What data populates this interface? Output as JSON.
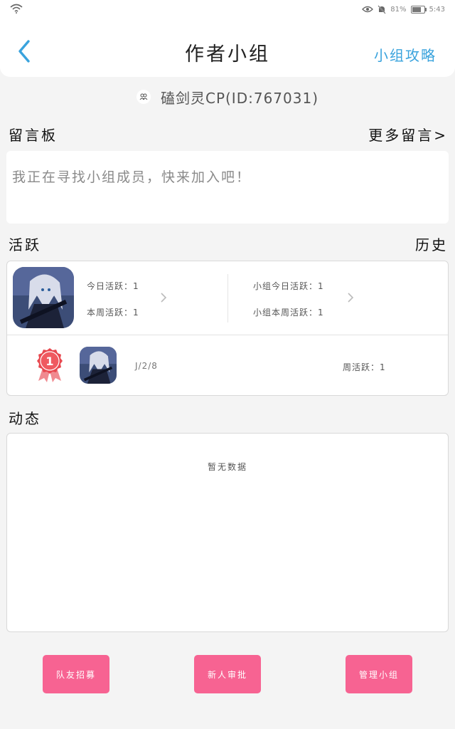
{
  "status_bar": {
    "battery_percent": "81%",
    "battery_level": 0.81,
    "time": "5:43"
  },
  "header": {
    "title": "作者小组",
    "guide_link": "小组攻略"
  },
  "group": {
    "name": "磕剑灵CP(ID:767031)"
  },
  "message_board": {
    "title": "留言板",
    "more_link": "更多留言>",
    "content": "我正在寻找小组成员，快来加入吧！"
  },
  "activity": {
    "title": "活跃",
    "history_link": "历史",
    "today_active": "今日活跃：1",
    "week_active": "本周活跃：1",
    "group_today_active": "小组今日活跃：1",
    "group_week_active": "小组本周活跃：1",
    "ranking": {
      "rank": "1",
      "user": "J/2/8",
      "week_active": "周活跃：1"
    }
  },
  "dynamics": {
    "title": "动态",
    "empty_text": "暂无数据"
  },
  "actions": {
    "recruit": "队友招募",
    "approve": "新人审批",
    "manage": "管理小组"
  },
  "colors": {
    "accent_blue": "#3aa3dd",
    "button_pink": "#f76392",
    "medal_red": "#e8484f"
  }
}
